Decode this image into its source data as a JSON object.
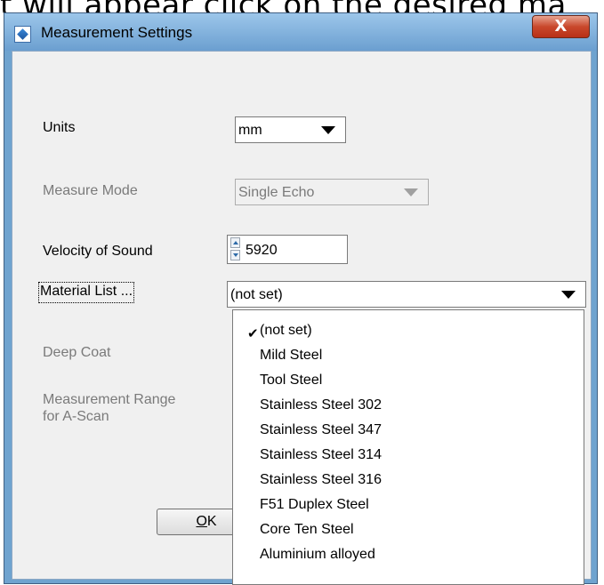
{
  "background_text": "t will appear click on the desired ma",
  "window": {
    "title": "Measurement Settings",
    "close_label": "X"
  },
  "fields": {
    "units_label": "Units",
    "units_value": "mm",
    "measure_mode_label": "Measure Mode",
    "measure_mode_value": "Single Echo",
    "velocity_label": "Velocity of Sound",
    "velocity_value": "5920",
    "material_list_label": "Material List ...",
    "material_value": "(not set)",
    "deep_coat_label": "Deep Coat",
    "measurement_range_label_1": "Measurement Range",
    "measurement_range_label_2": "for A-Scan"
  },
  "ok_button": {
    "accel": "O",
    "rest": "K"
  },
  "material_options": [
    "(not set)",
    "Mild Steel",
    "Tool Steel",
    "Stainless Steel 302",
    "Stainless Steel 347",
    "Stainless Steel 314",
    "Stainless Steel 316",
    "F51 Duplex Steel",
    "Core Ten Steel",
    "Aluminium alloyed"
  ],
  "selected_option_index": 0
}
